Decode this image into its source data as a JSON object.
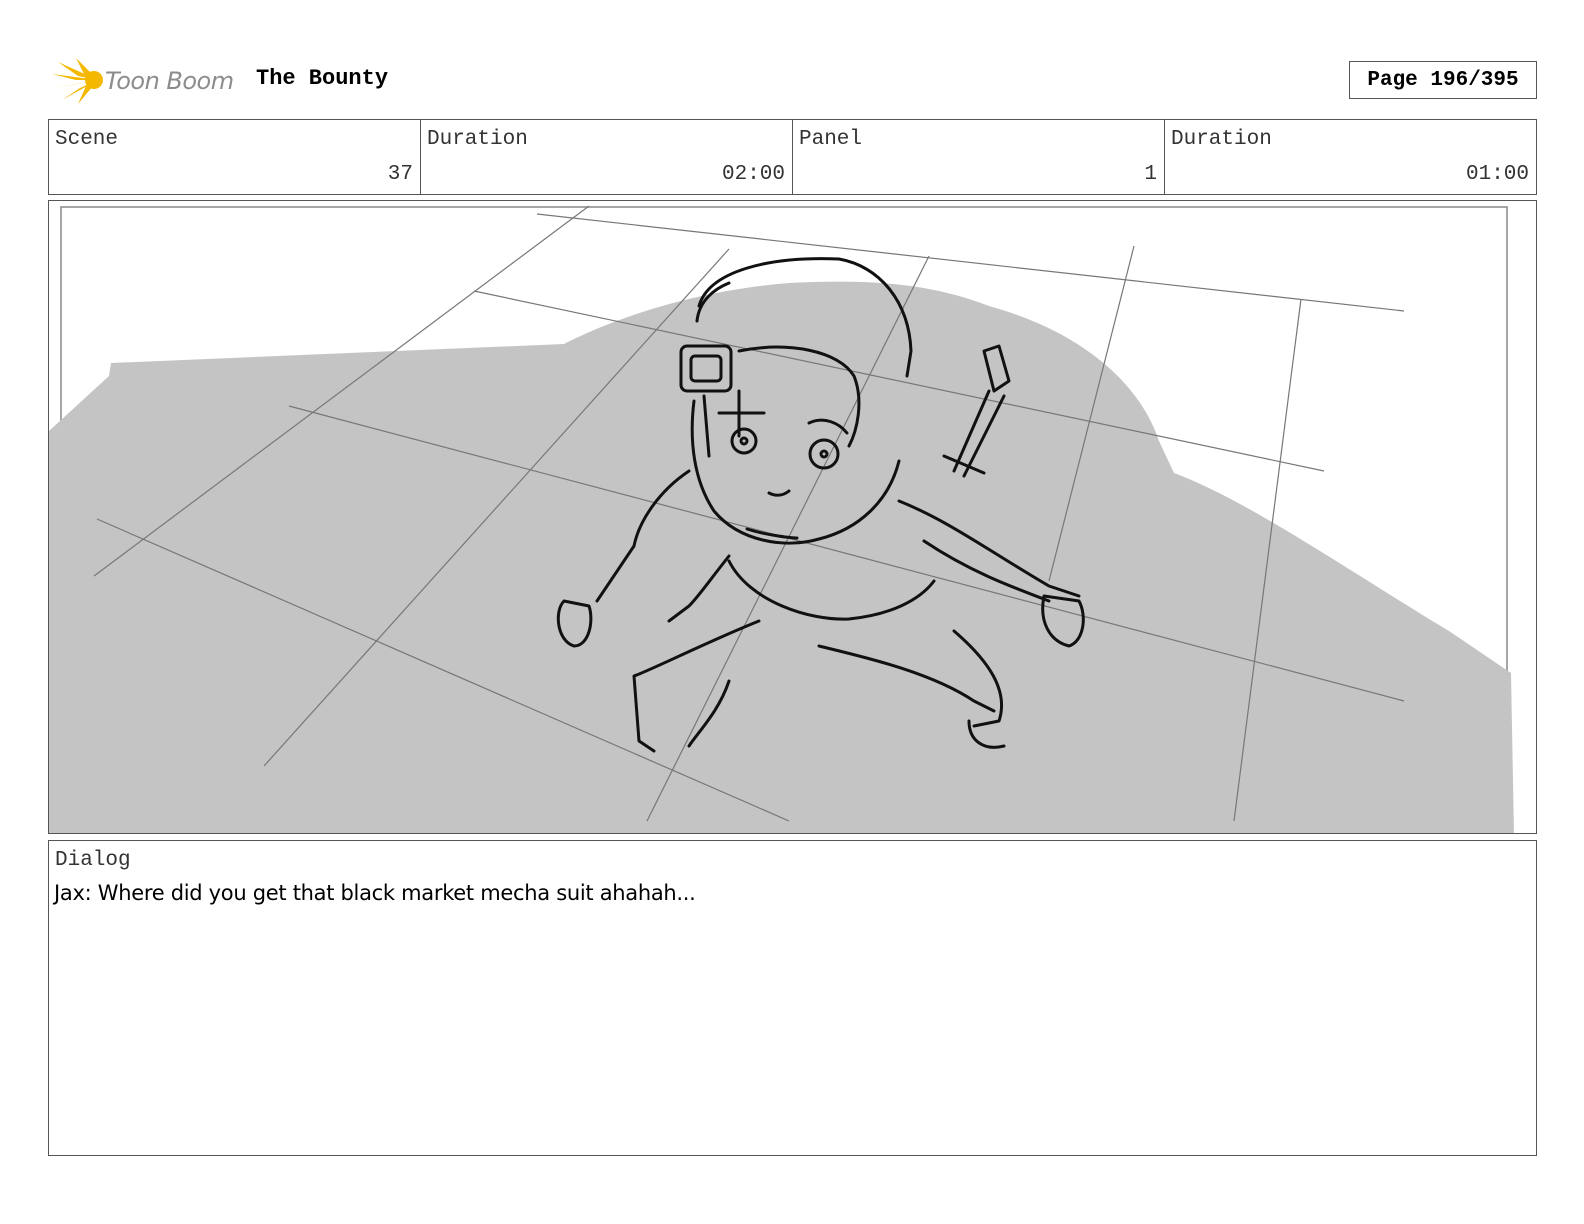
{
  "header": {
    "logo_text": "Toon Boom",
    "project_title": "The Bounty",
    "page_label": "Page 196/395"
  },
  "info": {
    "scene_label": "Scene",
    "scene_value": "37",
    "scene_duration_label": "Duration",
    "scene_duration_value": "02:00",
    "panel_label": "Panel",
    "panel_value": "1",
    "panel_duration_label": "Duration",
    "panel_duration_value": "01:00"
  },
  "dialog": {
    "label": "Dialog",
    "text": "Jax: Where did you get that black market mecha suit ahahah..."
  },
  "colors": {
    "logo_accent": "#f5b800",
    "shadow_fill": "#c4c4c4",
    "border": "#555555"
  }
}
